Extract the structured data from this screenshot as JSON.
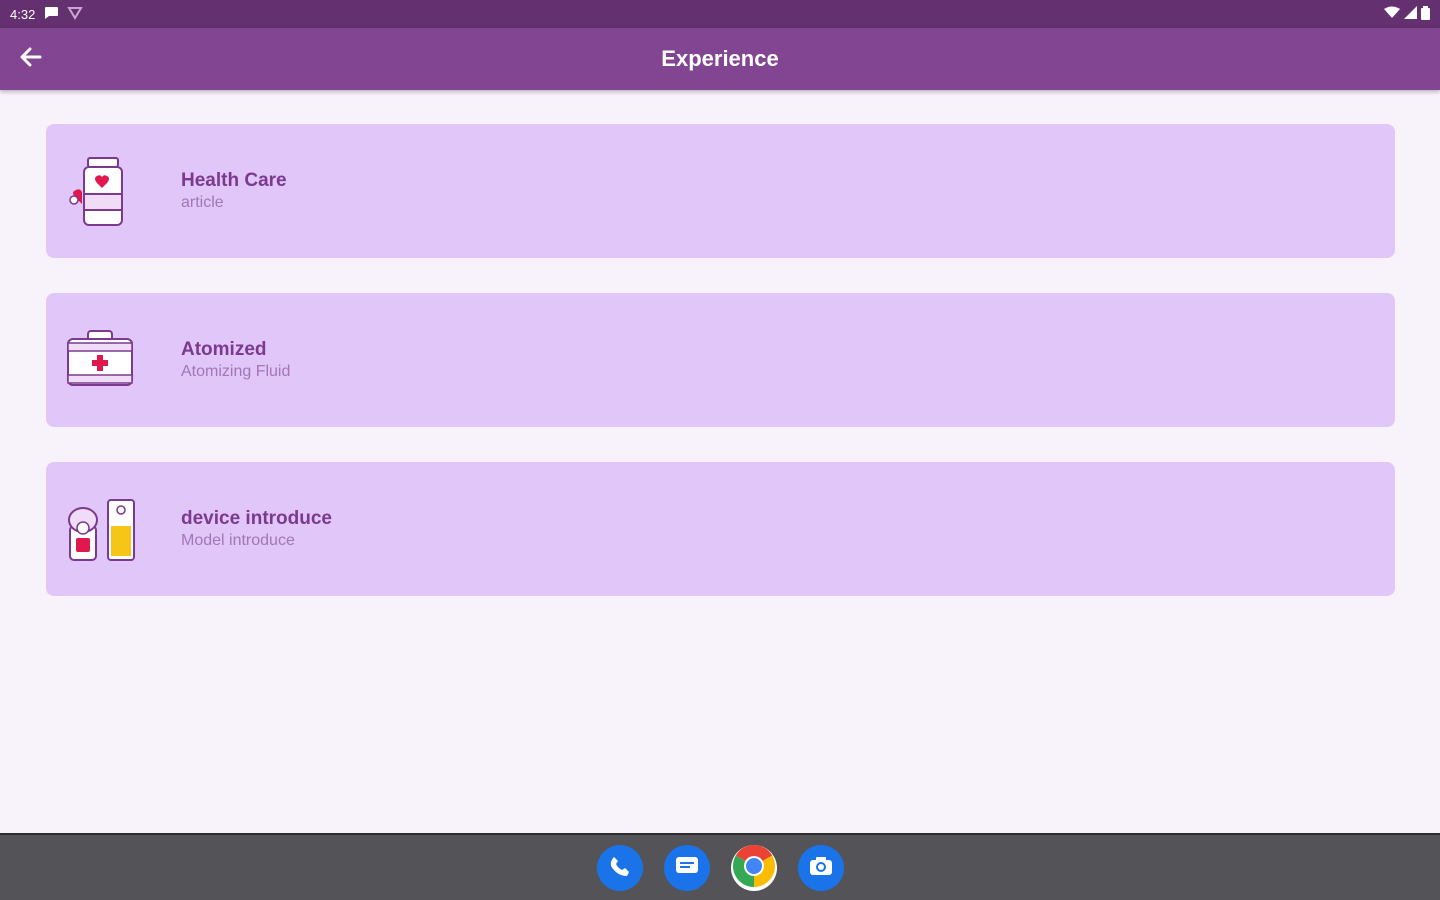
{
  "status_bar": {
    "time": "4:32"
  },
  "app_bar": {
    "title": "Experience"
  },
  "items": [
    {
      "title": "Health Care",
      "subtitle": "article",
      "icon": "medicine-bottle-icon"
    },
    {
      "title": "Atomized",
      "subtitle": "Atomizing Fluid",
      "icon": "first-aid-kit-icon"
    },
    {
      "title": "device introduce",
      "subtitle": "Model introduce",
      "icon": "device-icon"
    }
  ],
  "dock": [
    "phone-icon",
    "messages-icon",
    "chrome-icon",
    "camera-icon"
  ],
  "colors": {
    "status_bar": "#64306f",
    "app_bar": "#824592",
    "background": "#f8f2fb",
    "card": "#e1c6f9",
    "title_text": "#7b3a8f",
    "subtitle_text": "#a376b6",
    "nav_bar": "#535358"
  }
}
